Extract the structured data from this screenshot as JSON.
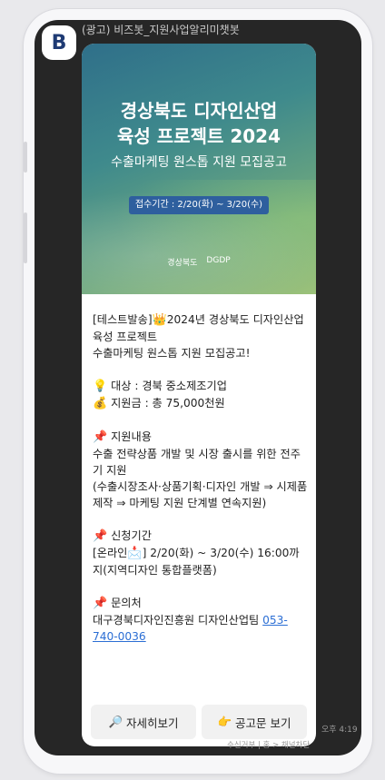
{
  "channel": {
    "profile_letter": "B",
    "sender_name": "(광고) 비즈봇_지원사업알리미챗봇"
  },
  "banner": {
    "title_line1": "경상북도 디자인산업",
    "title_line2": "육성 프로젝트 2024",
    "subtitle": "수출마케팅 원스톱 지원 모집공고",
    "period": "접수기간 : 2/20(화) ~ 3/20(수)",
    "logo1": "경상북도",
    "logo2": "DGDP"
  },
  "message": {
    "line1": "[테스트발송]",
    "line1_rest": "2024년 경상북도 디자인산업 육성 프로젝트",
    "line2": "수출마케팅 원스톱 지원 모집공고!",
    "target": "대상 : 경북 중소제조기업",
    "fund": "지원금 : 총 75,000천원",
    "support_title": "지원내용",
    "support_desc": "수출 전략상품 개발 및 시장 출시를 위한 전주기 지원",
    "support_detail": "(수출시장조사·상품기획·디자인 개발 ⇒ 시제품 제작 ⇒ 마케팅 지원 단계별 연속지원)",
    "period_title": "신청기간",
    "period_online": "[온라인",
    "period_desc": "] 2/20(화) ~ 3/20(수) 16:00까지(지역디자인 통합플랫폼)",
    "contact_title": "문의처",
    "contact_org": "대구경북디자인진흥원 디자인산업팀 ",
    "contact_phone": "053-740-0036"
  },
  "buttons": {
    "detail": "자세히보기",
    "notice": "공고문 보기"
  },
  "time": "오후 4:19",
  "footer": "수신거부 | 홈 > 채널차단"
}
